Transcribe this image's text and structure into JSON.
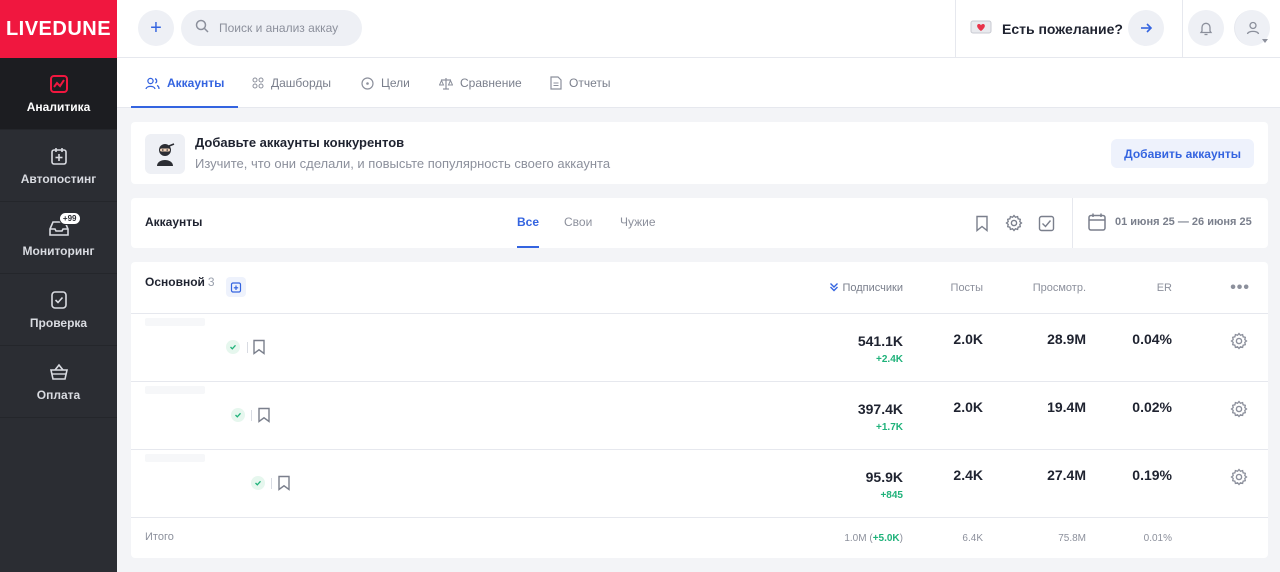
{
  "brand": {
    "logo_text": "LIVEDUNE",
    "logo_color": "#f0173f"
  },
  "sidebar": {
    "items": [
      {
        "label": "Аналитика",
        "icon": "chart-icon",
        "active": true
      },
      {
        "label": "Автопостинг",
        "icon": "calendar-plus-icon"
      },
      {
        "label": "Мониторинг",
        "icon": "inbox-icon",
        "badge": "+99"
      },
      {
        "label": "Проверка",
        "icon": "shield-check-icon"
      },
      {
        "label": "Оплата",
        "icon": "basket-icon"
      }
    ]
  },
  "header": {
    "add_button_label": "+",
    "search_placeholder": "Поиск и анализ аккаунта",
    "wish_label": "Есть пожелание?"
  },
  "tabs": [
    {
      "label": "Аккаунты",
      "icon": "users-icon",
      "active": true
    },
    {
      "label": "Дашборды",
      "icon": "grid-icon"
    },
    {
      "label": "Цели",
      "icon": "target-icon"
    },
    {
      "label": "Сравнение",
      "icon": "scales-icon"
    },
    {
      "label": "Отчеты",
      "icon": "document-icon"
    }
  ],
  "promo": {
    "title": "Добавьте аккаунты конкурентов",
    "subtitle": "Изучите, что они сделали, и повысьте популярность своего аккаунта",
    "button_label": "Добавить аккаунты"
  },
  "filters": {
    "title": "Аккаунты",
    "tabs": [
      "Все",
      "Свои",
      "Чужие"
    ],
    "active_tab": "Все",
    "date_range": "01 июня 25 — 26 июня 25"
  },
  "table": {
    "group_title": "Основной",
    "group_count": "3",
    "columns": [
      "Подписчики",
      "Посты",
      "Просмотр.",
      "ER"
    ],
    "rows": [
      {
        "subscribers": "541.1K",
        "subscribers_delta": "+2.4K",
        "posts": "2.0K",
        "views": "28.9M",
        "er": "0.04%"
      },
      {
        "subscribers": "397.4K",
        "subscribers_delta": "+1.7K",
        "posts": "2.0K",
        "views": "19.4M",
        "er": "0.02%"
      },
      {
        "subscribers": "95.9K",
        "subscribers_delta": "+845",
        "posts": "2.4K",
        "views": "27.4M",
        "er": "0.19%"
      }
    ],
    "total": {
      "label": "Итого",
      "subscribers": "1.0M",
      "subscribers_delta": "+5.0K",
      "posts": "6.4K",
      "views": "75.8M",
      "er": "0.01%"
    }
  },
  "colors": {
    "accent": "#3464e0",
    "positive": "#1fb27a",
    "sidebar_bg": "#2b2d33"
  }
}
